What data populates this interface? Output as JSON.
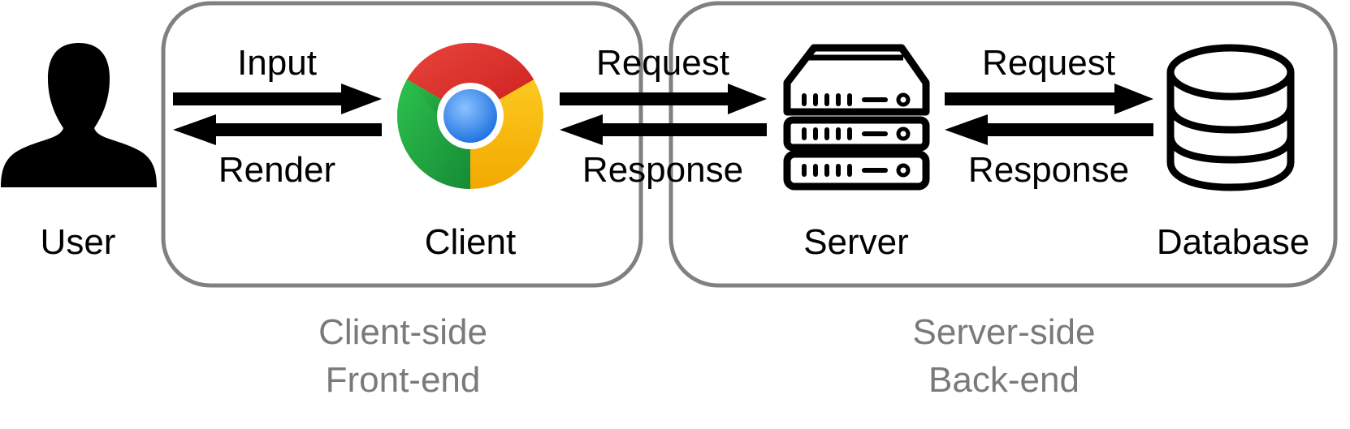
{
  "nodes": {
    "user": "User",
    "client": "Client",
    "server": "Server",
    "database": "Database"
  },
  "arrows": {
    "user_client_forward": "Input",
    "user_client_back": "Render",
    "client_server_forward": "Request",
    "client_server_back": "Response",
    "server_db_forward": "Request",
    "server_db_back": "Response"
  },
  "groups": {
    "client_side": {
      "line1": "Client-side",
      "line2": "Front-end"
    },
    "server_side": {
      "line1": "Server-side",
      "line2": "Back-end"
    }
  },
  "colors": {
    "group_border": "#808080",
    "group_text": "#7a7a7a",
    "chrome_red": "#db3236",
    "chrome_yellow": "#f4c20d",
    "chrome_green": "#3cba54",
    "chrome_blue": "#4285f4"
  },
  "icons": {
    "user": "user-silhouette-icon",
    "client": "chrome-browser-icon",
    "server": "server-rack-icon",
    "database": "database-icon"
  }
}
